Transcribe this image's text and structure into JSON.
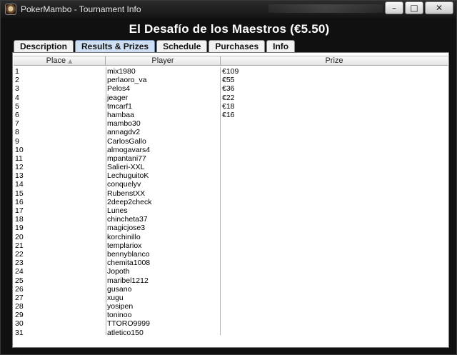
{
  "window": {
    "title": "PokerMambo - Tournament Info",
    "buttons": {
      "minimize": "–",
      "maximize": "□",
      "close": "✕"
    }
  },
  "heading": "El Desafío de los Maestros (€5.50)",
  "tabs": [
    {
      "label": "Description",
      "active": false
    },
    {
      "label": "Results & Prizes",
      "active": true
    },
    {
      "label": "Schedule",
      "active": false
    },
    {
      "label": "Purchases",
      "active": false
    },
    {
      "label": "Info",
      "active": false
    }
  ],
  "table": {
    "headers": {
      "place": "Place",
      "player": "Player",
      "prize": "Prize"
    },
    "sort_indicator": "▲",
    "rows": [
      {
        "place": "1",
        "player": "mix1980",
        "prize": "€109"
      },
      {
        "place": "2",
        "player": "perlaoro_va",
        "prize": "€55"
      },
      {
        "place": "3",
        "player": "Pelos4",
        "prize": "€36"
      },
      {
        "place": "4",
        "player": "jeager",
        "prize": "€22"
      },
      {
        "place": "5",
        "player": "tmcarf1",
        "prize": "€18"
      },
      {
        "place": "6",
        "player": "hambaa",
        "prize": "€16"
      },
      {
        "place": "7",
        "player": "mambo30",
        "prize": ""
      },
      {
        "place": "8",
        "player": "annagdv2",
        "prize": ""
      },
      {
        "place": "9",
        "player": "CarlosGallo",
        "prize": ""
      },
      {
        "place": "10",
        "player": "almogavars4",
        "prize": ""
      },
      {
        "place": "11",
        "player": "mpantani77",
        "prize": ""
      },
      {
        "place": "12",
        "player": "Salieri-XXL",
        "prize": ""
      },
      {
        "place": "13",
        "player": "LechuguitoK",
        "prize": ""
      },
      {
        "place": "14",
        "player": "conquelyv",
        "prize": ""
      },
      {
        "place": "15",
        "player": "RubenstXX",
        "prize": ""
      },
      {
        "place": "16",
        "player": "2deep2check",
        "prize": ""
      },
      {
        "place": "17",
        "player": "Lunes",
        "prize": ""
      },
      {
        "place": "18",
        "player": "chincheta37",
        "prize": ""
      },
      {
        "place": "19",
        "player": "magicjose3",
        "prize": ""
      },
      {
        "place": "20",
        "player": "korchinillo",
        "prize": ""
      },
      {
        "place": "21",
        "player": "templariox",
        "prize": ""
      },
      {
        "place": "22",
        "player": "bennyblanco",
        "prize": ""
      },
      {
        "place": "23",
        "player": "chemita1008",
        "prize": ""
      },
      {
        "place": "24",
        "player": "Jopoth",
        "prize": ""
      },
      {
        "place": "25",
        "player": "maribel1212",
        "prize": ""
      },
      {
        "place": "26",
        "player": "gusano",
        "prize": ""
      },
      {
        "place": "27",
        "player": "xugu",
        "prize": ""
      },
      {
        "place": "28",
        "player": "yosipen",
        "prize": ""
      },
      {
        "place": "29",
        "player": "toninoo",
        "prize": ""
      },
      {
        "place": "30",
        "player": "TTORO9999",
        "prize": ""
      },
      {
        "place": "31",
        "player": "atletico150",
        "prize": ""
      }
    ]
  },
  "colors": {
    "window_bg": "#101010",
    "active_tab": "#cfe0f4",
    "panel_bg": "#ffffff"
  }
}
